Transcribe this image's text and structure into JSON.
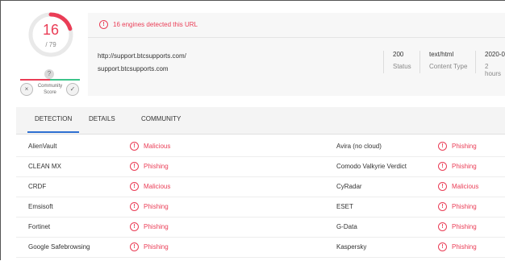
{
  "score": {
    "detected": "16",
    "total": "/ 79",
    "ring_color": "#ea3d56",
    "ring_fraction": 0.2025
  },
  "community": {
    "question_glyph": "?",
    "label_line1": "Community",
    "label_line2": "Score",
    "vote_down_glyph": "×",
    "vote_up_glyph": "✓"
  },
  "header": {
    "alert_glyph": "!",
    "alert_text": "16 engines detected this URL",
    "url": "http://support.btcsupports.com/",
    "host": "support.btcsupports.com",
    "status_value": "200",
    "status_label": "Status",
    "content_type_value": "text/html",
    "content_type_label": "Content Type",
    "date_value": "2020-0",
    "date_label": "2 hours"
  },
  "tabs": [
    {
      "label": "DETECTION",
      "active": true
    },
    {
      "label": "DETAILS",
      "active": false
    },
    {
      "label": "COMMUNITY",
      "active": false
    }
  ],
  "detections": [
    {
      "left_engine": "AlienVault",
      "left_result": "Malicious",
      "right_engine": "Avira (no cloud)",
      "right_result": "Phishing"
    },
    {
      "left_engine": "CLEAN MX",
      "left_result": "Phishing",
      "right_engine": "Comodo Valkyrie Verdict",
      "right_result": "Phishing"
    },
    {
      "left_engine": "CRDF",
      "left_result": "Malicious",
      "right_engine": "CyRadar",
      "right_result": "Malicious"
    },
    {
      "left_engine": "Emsisoft",
      "left_result": "Phishing",
      "right_engine": "ESET",
      "right_result": "Phishing"
    },
    {
      "left_engine": "Fortinet",
      "left_result": "Phishing",
      "right_engine": "G-Data",
      "right_result": "Phishing"
    },
    {
      "left_engine": "Google Safebrowsing",
      "left_result": "Phishing",
      "right_engine": "Kaspersky",
      "right_result": "Phishing"
    }
  ],
  "result_glyph": "!",
  "colors": {
    "alert": "#ea3d56",
    "tab_active": "#2f6fd1",
    "community_negative": "#ea3d56",
    "community_positive": "#3cc48a"
  }
}
